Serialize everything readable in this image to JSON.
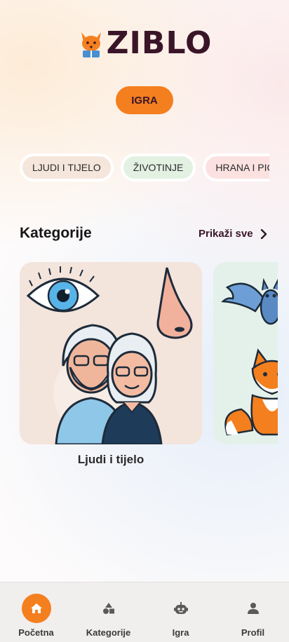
{
  "app": {
    "logo_text": "ZIBLO"
  },
  "play_button": {
    "label": "IGRA"
  },
  "chips": [
    {
      "label": "LJUDI I TIJELO",
      "color": "#f5e6dc"
    },
    {
      "label": "ŽIVOTINJE",
      "color": "#e3f1e3"
    },
    {
      "label": "HRANA I PIĆE",
      "color": "#fbe2e0"
    }
  ],
  "categories_section": {
    "title": "Kategorije",
    "show_all_label": "Prikaži sve",
    "cards": [
      {
        "label": "Ljudi i tijelo",
        "bg": "#f3e4dc"
      },
      {
        "label": "",
        "bg": "#e4f1ea"
      }
    ]
  },
  "tabbar": {
    "items": [
      {
        "label": "Početna",
        "icon": "home-icon",
        "active": true
      },
      {
        "label": "Kategorije",
        "icon": "shapes-icon",
        "active": false
      },
      {
        "label": "Igra",
        "icon": "robot-icon",
        "active": false
      },
      {
        "label": "Profil",
        "icon": "person-icon",
        "active": false
      }
    ]
  },
  "colors": {
    "accent": "#f47f1f",
    "brand_dark": "#3a1528"
  }
}
